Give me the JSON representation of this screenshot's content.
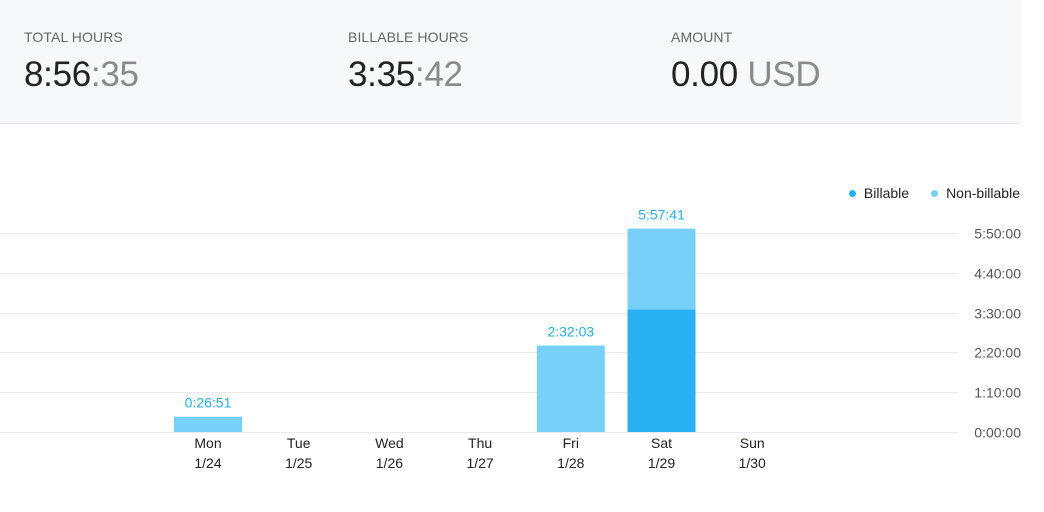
{
  "summary": {
    "total": {
      "label": "TOTAL HOURS",
      "main": "8:56",
      "dim": ":35"
    },
    "billable": {
      "label": "BILLABLE HOURS",
      "main": "3:35",
      "dim": ":42"
    },
    "amount": {
      "label": "AMOUNT",
      "main": "0.00",
      "dim": " USD"
    }
  },
  "legend": [
    {
      "name": "Billable",
      "color": "#29b0f3"
    },
    {
      "name": "Non-billable",
      "color": "#76d0f8"
    }
  ],
  "chart_data": {
    "type": "bar",
    "stacked": true,
    "categories": [
      {
        "day": "Mon",
        "date": "1/24"
      },
      {
        "day": "Tue",
        "date": "1/25"
      },
      {
        "day": "Wed",
        "date": "1/26"
      },
      {
        "day": "Thu",
        "date": "1/27"
      },
      {
        "day": "Fri",
        "date": "1/28"
      },
      {
        "day": "Sat",
        "date": "1/29"
      },
      {
        "day": "Sun",
        "date": "1/30"
      }
    ],
    "series": [
      {
        "name": "Billable",
        "color": "#29b0f3",
        "values": [
          0,
          0,
          0,
          0,
          0,
          215.7,
          0
        ]
      },
      {
        "name": "Non-billable",
        "color": "#76d0f8",
        "values": [
          26.85,
          0,
          0,
          0,
          152.05,
          141.98,
          0
        ]
      }
    ],
    "totals": [
      "0:26:51",
      "",
      "",
      "",
      "2:32:03",
      "5:57:41",
      ""
    ],
    "yticks": [
      "0:00:00",
      "1:10:00",
      "2:20:00",
      "3:30:00",
      "4:40:00",
      "5:50:00"
    ],
    "ytick_values": [
      0,
      70,
      140,
      210,
      280,
      350
    ],
    "ylim": [
      0,
      350
    ],
    "grid": true,
    "legend_position": "top-right"
  }
}
